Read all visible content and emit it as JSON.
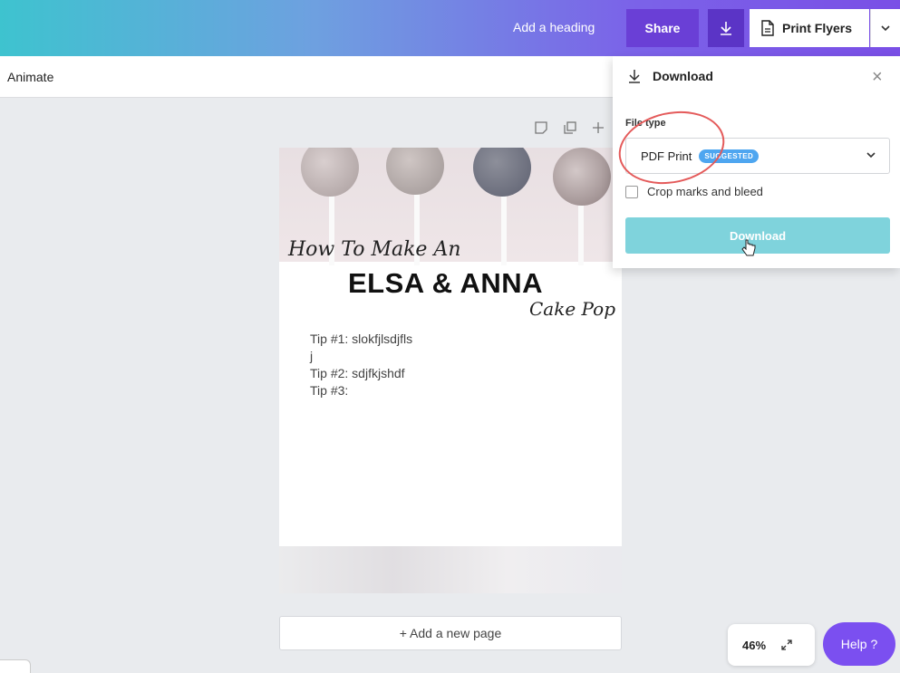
{
  "topbar": {
    "heading_link": "Add a heading",
    "share_label": "Share",
    "download_icon": "download-icon",
    "print_label": "Print Flyers",
    "print_icon": "print-document-icon",
    "caret_icon": "chevron-down-icon"
  },
  "subbar": {
    "animate_label": "Animate"
  },
  "design": {
    "script_line1": "How To Make An",
    "title": "ELSA & ANNA",
    "script_line2": "Cake Pop",
    "tips": [
      "Tip #1: slokfjlsdjfls",
      "j",
      "Tip #2: sdjfkjshdf",
      "",
      "Tip #3:"
    ]
  },
  "add_page_label": "+ Add a new page",
  "zoom": {
    "value": "46%",
    "icon": "expand-icon"
  },
  "help_label": "Help ?",
  "download_panel": {
    "title": "Download",
    "file_type_label": "File type",
    "selected_type": "PDF Print",
    "badge": "SUGGESTED",
    "crop_label": "Crop marks and bleed",
    "button_label": "Download"
  },
  "colors": {
    "accent": "#7b4ff0",
    "download_button": "#7fd3dc",
    "annotation": "#e45a5a"
  }
}
